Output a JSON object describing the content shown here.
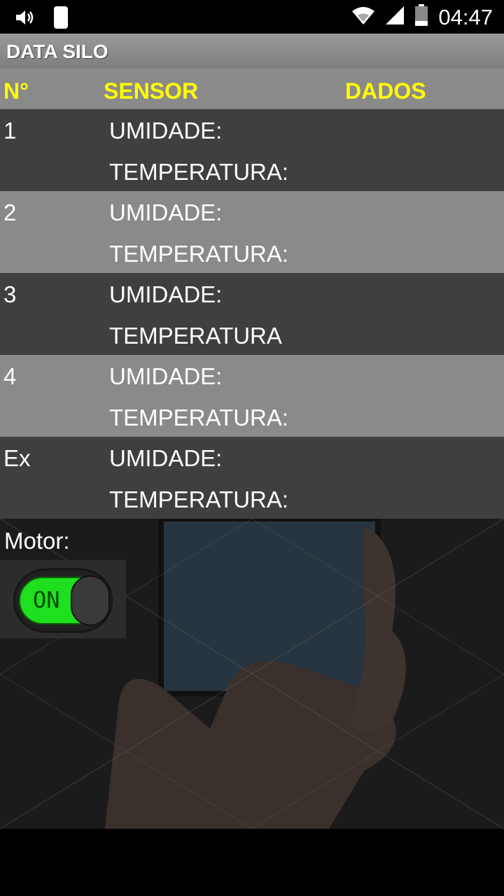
{
  "status_bar": {
    "time": "04:47",
    "icons": [
      "volume-icon",
      "notification-icon",
      "wifi-icon",
      "signal-icon",
      "battery-icon"
    ]
  },
  "app": {
    "title": "DATA SILO"
  },
  "table": {
    "headers": {
      "number": "N°",
      "sensor": "SENSOR",
      "data": "DADOS"
    },
    "rows": [
      {
        "id": "1",
        "line1": "UMIDADE:",
        "line2": "TEMPERATURA:"
      },
      {
        "id": "2",
        "line1": "UMIDADE:",
        "line2": "TEMPERATURA:"
      },
      {
        "id": "3",
        "line1": "UMIDADE:",
        "line2": "TEMPERATURA"
      },
      {
        "id": "4",
        "line1": "UMIDADE:",
        "line2": "TEMPERATURA:"
      },
      {
        "id": "Ex",
        "line1": "UMIDADE:",
        "line2": "TEMPERATURA:"
      }
    ]
  },
  "motor": {
    "label": "Motor:",
    "switch_text": "ON",
    "state": "on"
  },
  "colors": {
    "header_text": "#ffff00",
    "row_dark": "#3f3f3f",
    "row_light": "#8a8a8a",
    "switch_on": "#1fe01f"
  }
}
